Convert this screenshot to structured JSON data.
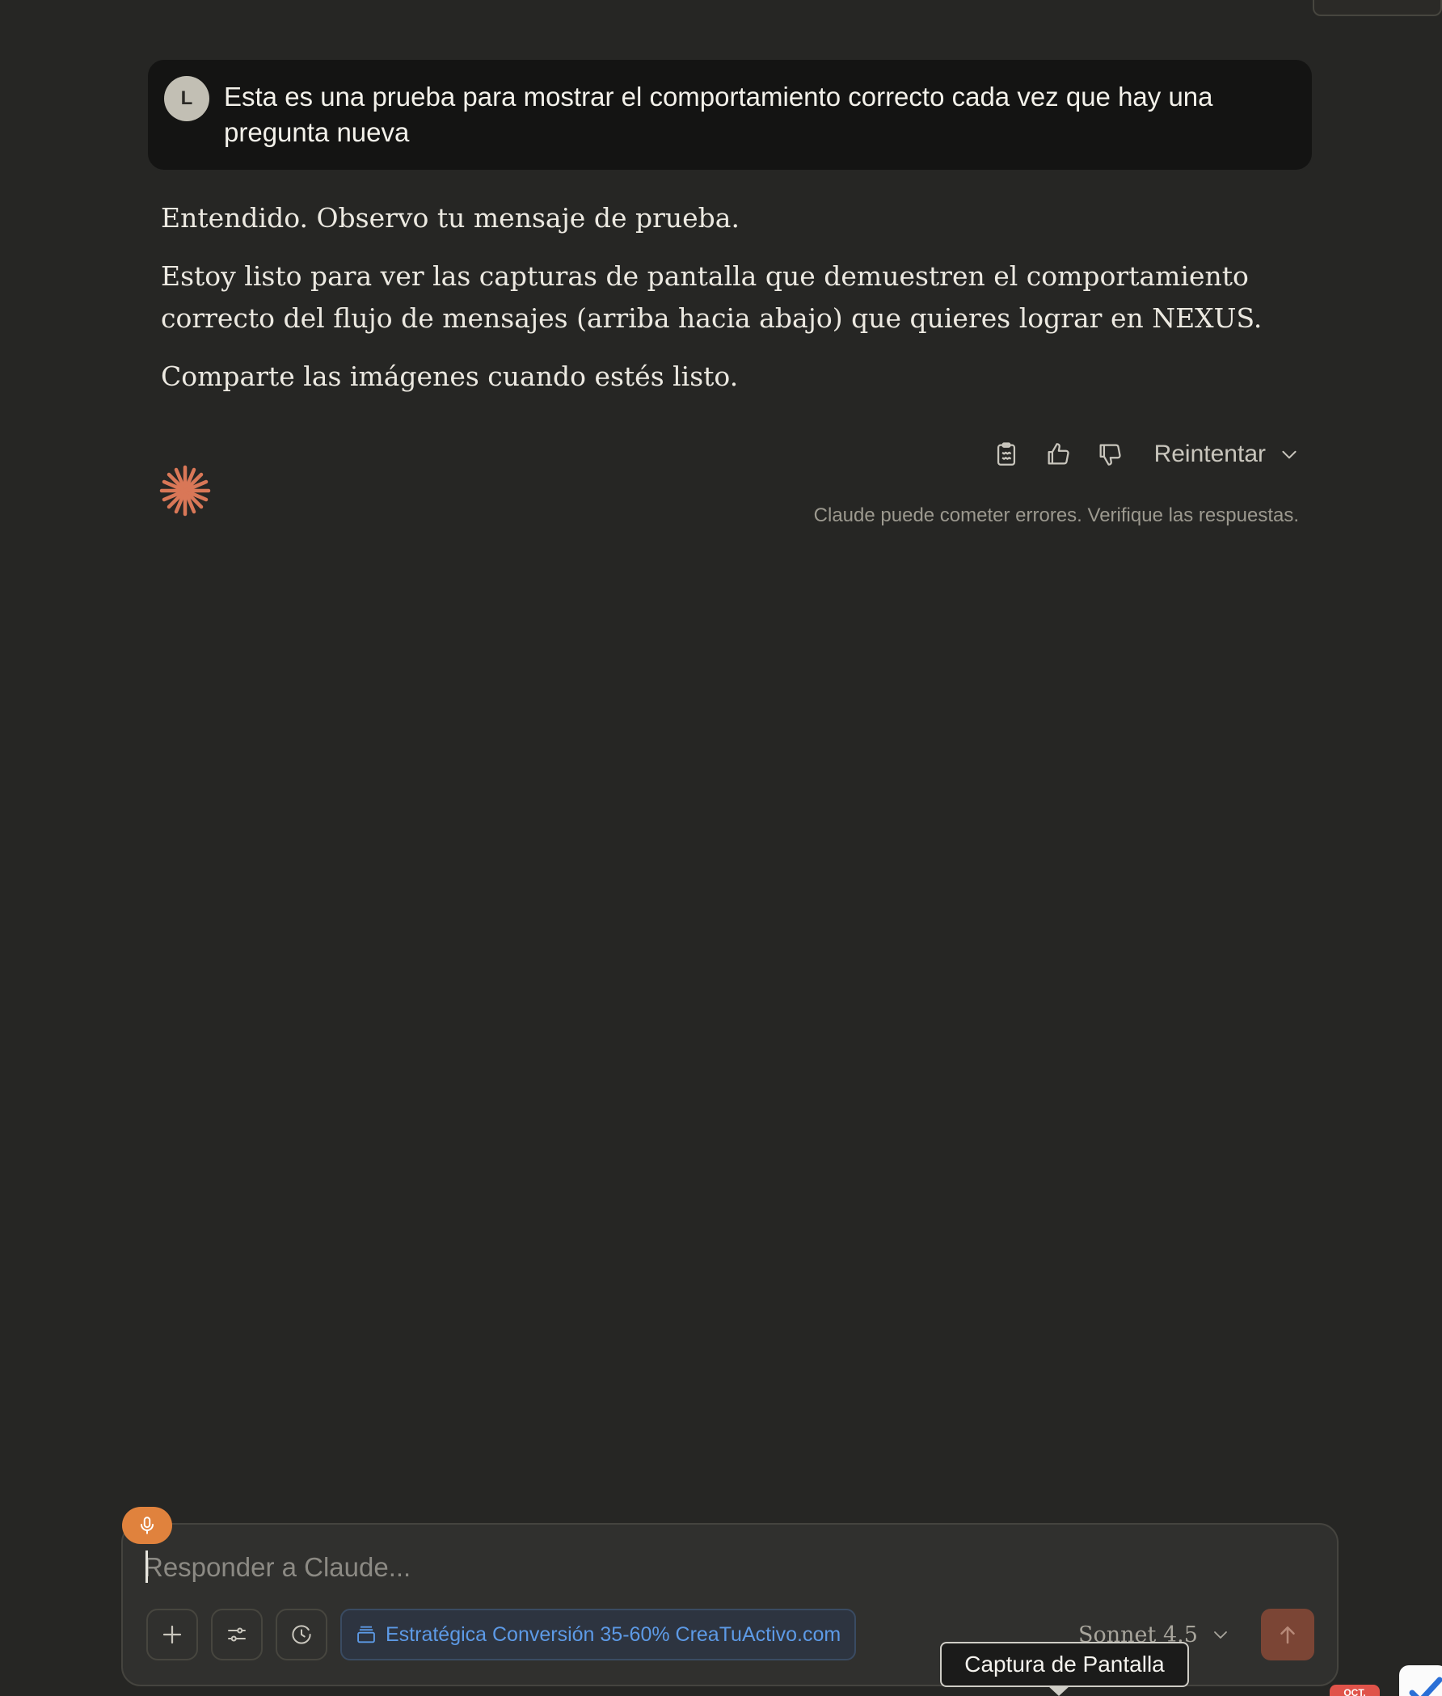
{
  "conversation": {
    "user_message": {
      "avatar_initial": "L",
      "text": "Esta es una prueba para mostrar el comportamiento correcto cada vez que hay una pregunta nueva"
    },
    "assistant_message": {
      "paragraphs": [
        "Entendido. Observo tu mensaje de prueba.",
        "Estoy listo para ver las capturas de pantalla que demuestren el comportamiento correcto del flujo de mensajes (arriba hacia abajo) que quieres lograr en NEXUS.",
        "Comparte las imágenes cuando estés listo."
      ]
    },
    "actions": {
      "copy_icon": "clipboard-icon",
      "like_icon": "thumbs-up-icon",
      "dislike_icon": "thumbs-down-icon",
      "retry_label": "Reintentar"
    },
    "disclaimer": "Claude puede cometer errores. Verifique las respuestas."
  },
  "composer": {
    "placeholder": "Responder a Claude...",
    "project_chip_label": "Estratégica Conversión 35-60% CreaTuActivo.com",
    "model_label": "Sonnet 4.5"
  },
  "tooltip": {
    "label": "Captura de Pantalla"
  },
  "dock": {
    "calendar_month": "OCT."
  },
  "colors": {
    "background": "#262624",
    "user_bubble": "#141413",
    "accent_orange": "#e0823d",
    "spark": "#d97757",
    "link_blue": "#5d9ae6",
    "send_button": "#7b4535"
  }
}
